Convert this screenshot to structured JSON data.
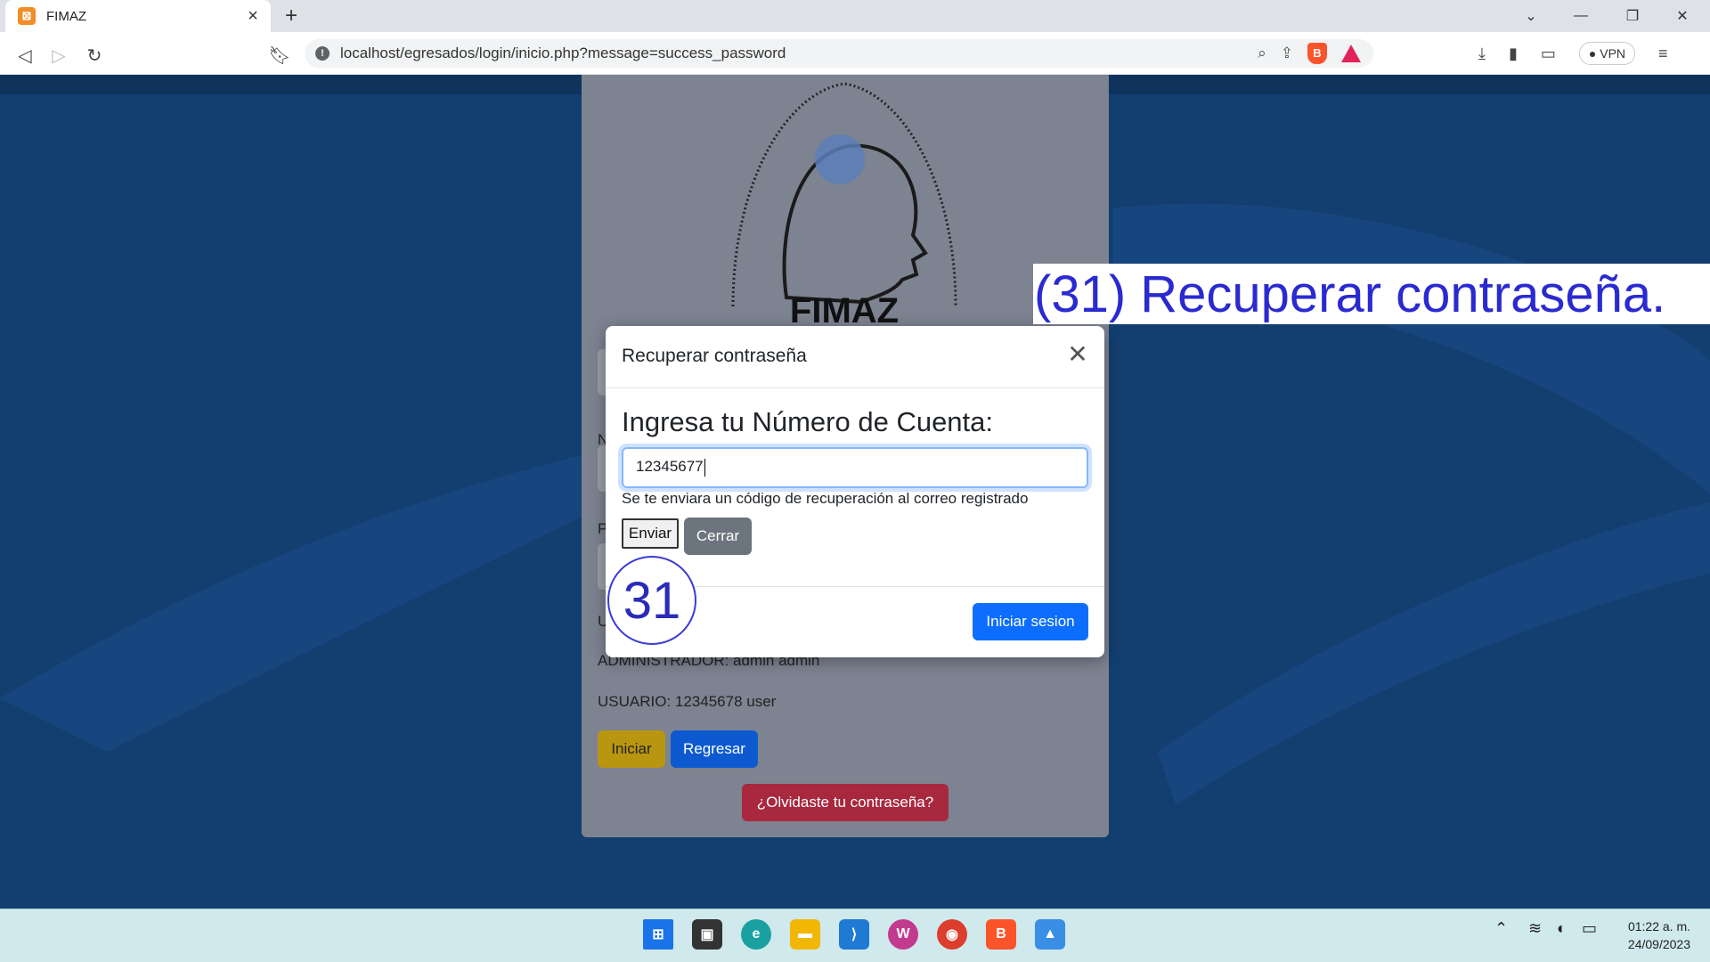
{
  "browser": {
    "tab_title": "FIMAZ",
    "tab_favicon": "xampp-icon",
    "url": "localhost/egresados/login/inicio.php?message=success_password",
    "vpn_label": "VPN"
  },
  "page": {
    "logo_text": "FIMAZ",
    "login_label_user": "N",
    "login_label_pass": "P",
    "hint_u": "U",
    "admin_hint": "ADMINISTRADOR: admin admin",
    "user_hint": "USUARIO: 12345678 user",
    "iniciar_label": "Iniciar",
    "regresar_label": "Regresar",
    "forgot_label": "¿Olvidaste tu contraseña?"
  },
  "modal": {
    "title": "Recuperar contraseña",
    "heading": "Ingresa tu Número de Cuenta:",
    "input_value": "12345677",
    "help_text": "Se te enviara un código de recuperación al correo registrado",
    "enviar_label": "Enviar",
    "cerrar_label": "Cerrar",
    "iniciar_sesion_label": "Iniciar sesion"
  },
  "annotation": {
    "step_number": "31",
    "step_text": "(31) Recuperar contraseña."
  },
  "taskbar": {
    "time": "01:22 a. m.",
    "date": "24/09/2023"
  },
  "colors": {
    "primary": "#0d6efd",
    "secondary": "#6c757d",
    "warning": "#b8960f",
    "danger": "#a8283e",
    "annotation_blue": "#2a2ad0"
  }
}
